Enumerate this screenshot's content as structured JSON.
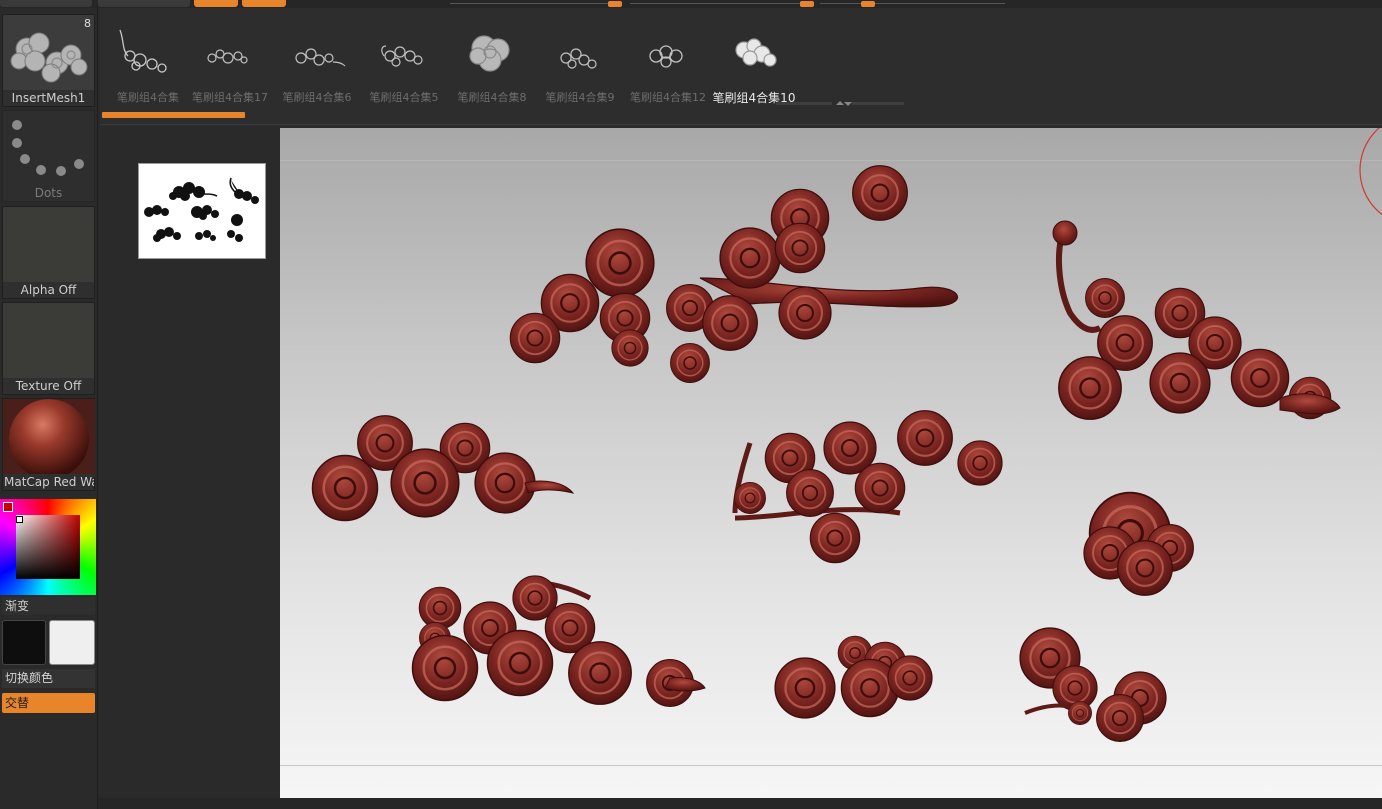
{
  "left_tray": {
    "insert_mesh": {
      "label": "InsertMesh1",
      "count": "8"
    },
    "stroke": {
      "label": "Dots"
    },
    "alpha": {
      "label": "Alpha Off"
    },
    "texture": {
      "label": "Texture Off"
    },
    "material": {
      "label": "MatCap Red Wax"
    },
    "gradient_label": "渐变",
    "switch_color_label": "切换颜色",
    "alternate_label": "交替"
  },
  "brushes": [
    {
      "label": "笔刷组4合集",
      "icon": "cloud-brush-icon"
    },
    {
      "label": "笔刷组4合集17",
      "icon": "cloud-brush-icon"
    },
    {
      "label": "笔刷组4合集6",
      "icon": "cloud-brush-icon"
    },
    {
      "label": "笔刷组4合集5",
      "icon": "cloud-brush-icon"
    },
    {
      "label": "笔刷组4合集8",
      "icon": "cloud-brush-icon"
    },
    {
      "label": "笔刷组4合集9",
      "icon": "cloud-brush-icon"
    },
    {
      "label": "笔刷组4合集12",
      "icon": "cloud-brush-icon"
    },
    {
      "label": "笔刷组4合集10",
      "icon": "cloud-brush-icon",
      "active": true
    }
  ],
  "colors": {
    "accent": "#e8852a",
    "cloud": "#7a2420",
    "primary_color": "#101010",
    "secondary_color": "#f0f0f0"
  }
}
